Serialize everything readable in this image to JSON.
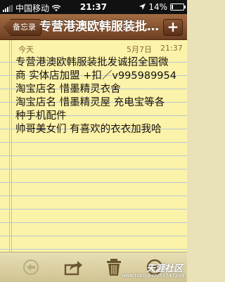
{
  "status_bar": {
    "carrier": "中国移动",
    "time": "21:37",
    "battery": "14%",
    "battery_level": 0.14
  },
  "nav": {
    "back_label": "备忘录",
    "title": "专营港澳欧韩服装批…",
    "add_icon": "plus-icon"
  },
  "note": {
    "day_label": "今天",
    "date": "5月7日",
    "time": "21:37",
    "lines": [
      "专营港澳欧韩服装批发诚招全国微",
      "商 实体店加盟 +扣／v995989954",
      "淘宝店名 惜墨精灵衣舍",
      "淘宝店名 惜墨精灵屋 充电宝等各",
      "种手机配件",
      "帅哥美女们 有喜欢的衣衣加我哈"
    ]
  },
  "toolbar": {
    "icons": [
      "back-arrow-icon",
      "share-icon",
      "trash-icon",
      "forward-arrow-icon"
    ]
  },
  "watermark": {
    "site": "天涯社区",
    "url": "www.tianya.cn/53747204"
  }
}
